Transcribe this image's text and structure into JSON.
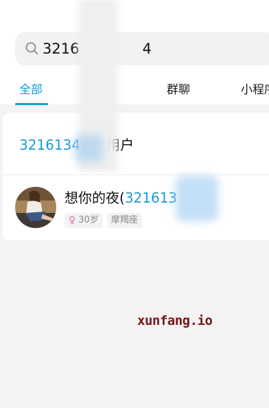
{
  "search": {
    "query": "3216",
    "query_suffix": "4",
    "icon": "search-icon"
  },
  "tabs": [
    {
      "label": "全部",
      "active": true
    },
    {
      "label": "群聊",
      "active": false
    },
    {
      "label": "小程序",
      "active": false
    }
  ],
  "results": {
    "user_search": {
      "query": "3216134",
      "suffix": "用户"
    },
    "user": {
      "name_prefix": "想你的夜(",
      "name_highlight": "321613",
      "gender_icon": "female-icon",
      "age": "30岁",
      "zodiac": "摩羯座"
    }
  },
  "watermark": "xunfang.io",
  "colors": {
    "accent": "#1a9ad6",
    "female": "#e86aa8",
    "watermark": "#7a1515"
  }
}
